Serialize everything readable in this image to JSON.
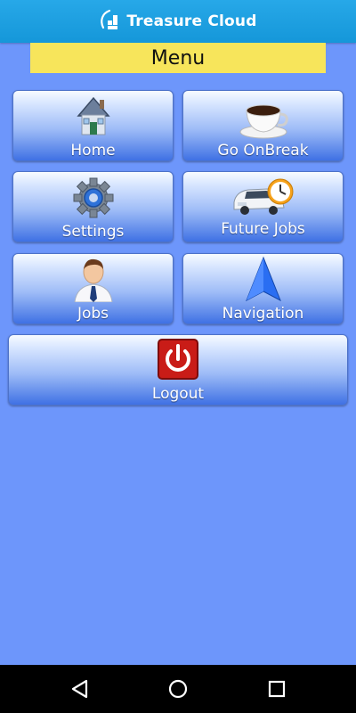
{
  "app": {
    "brand": "Treasure Cloud",
    "menu_title": "Menu"
  },
  "tiles": [
    {
      "label": "Home",
      "icon": "house-icon"
    },
    {
      "label": "Go OnBreak",
      "icon": "coffee-cup-icon"
    },
    {
      "label": "Settings",
      "icon": "gear-icon"
    },
    {
      "label": "Future Jobs",
      "icon": "car-clock-icon"
    },
    {
      "label": "Jobs",
      "icon": "person-icon"
    },
    {
      "label": "Navigation",
      "icon": "navigation-arrow-icon"
    },
    {
      "label": "Logout",
      "icon": "power-icon"
    }
  ],
  "navbar": {
    "buttons": [
      "back-icon",
      "home-circle-icon",
      "recents-square-icon"
    ]
  },
  "colors": {
    "background": "#6d96fb",
    "topbar": "#1597d9",
    "menu_banner": "#f7e55b",
    "tile_dark": "#3f71e4",
    "logout_red": "#c91c17"
  }
}
